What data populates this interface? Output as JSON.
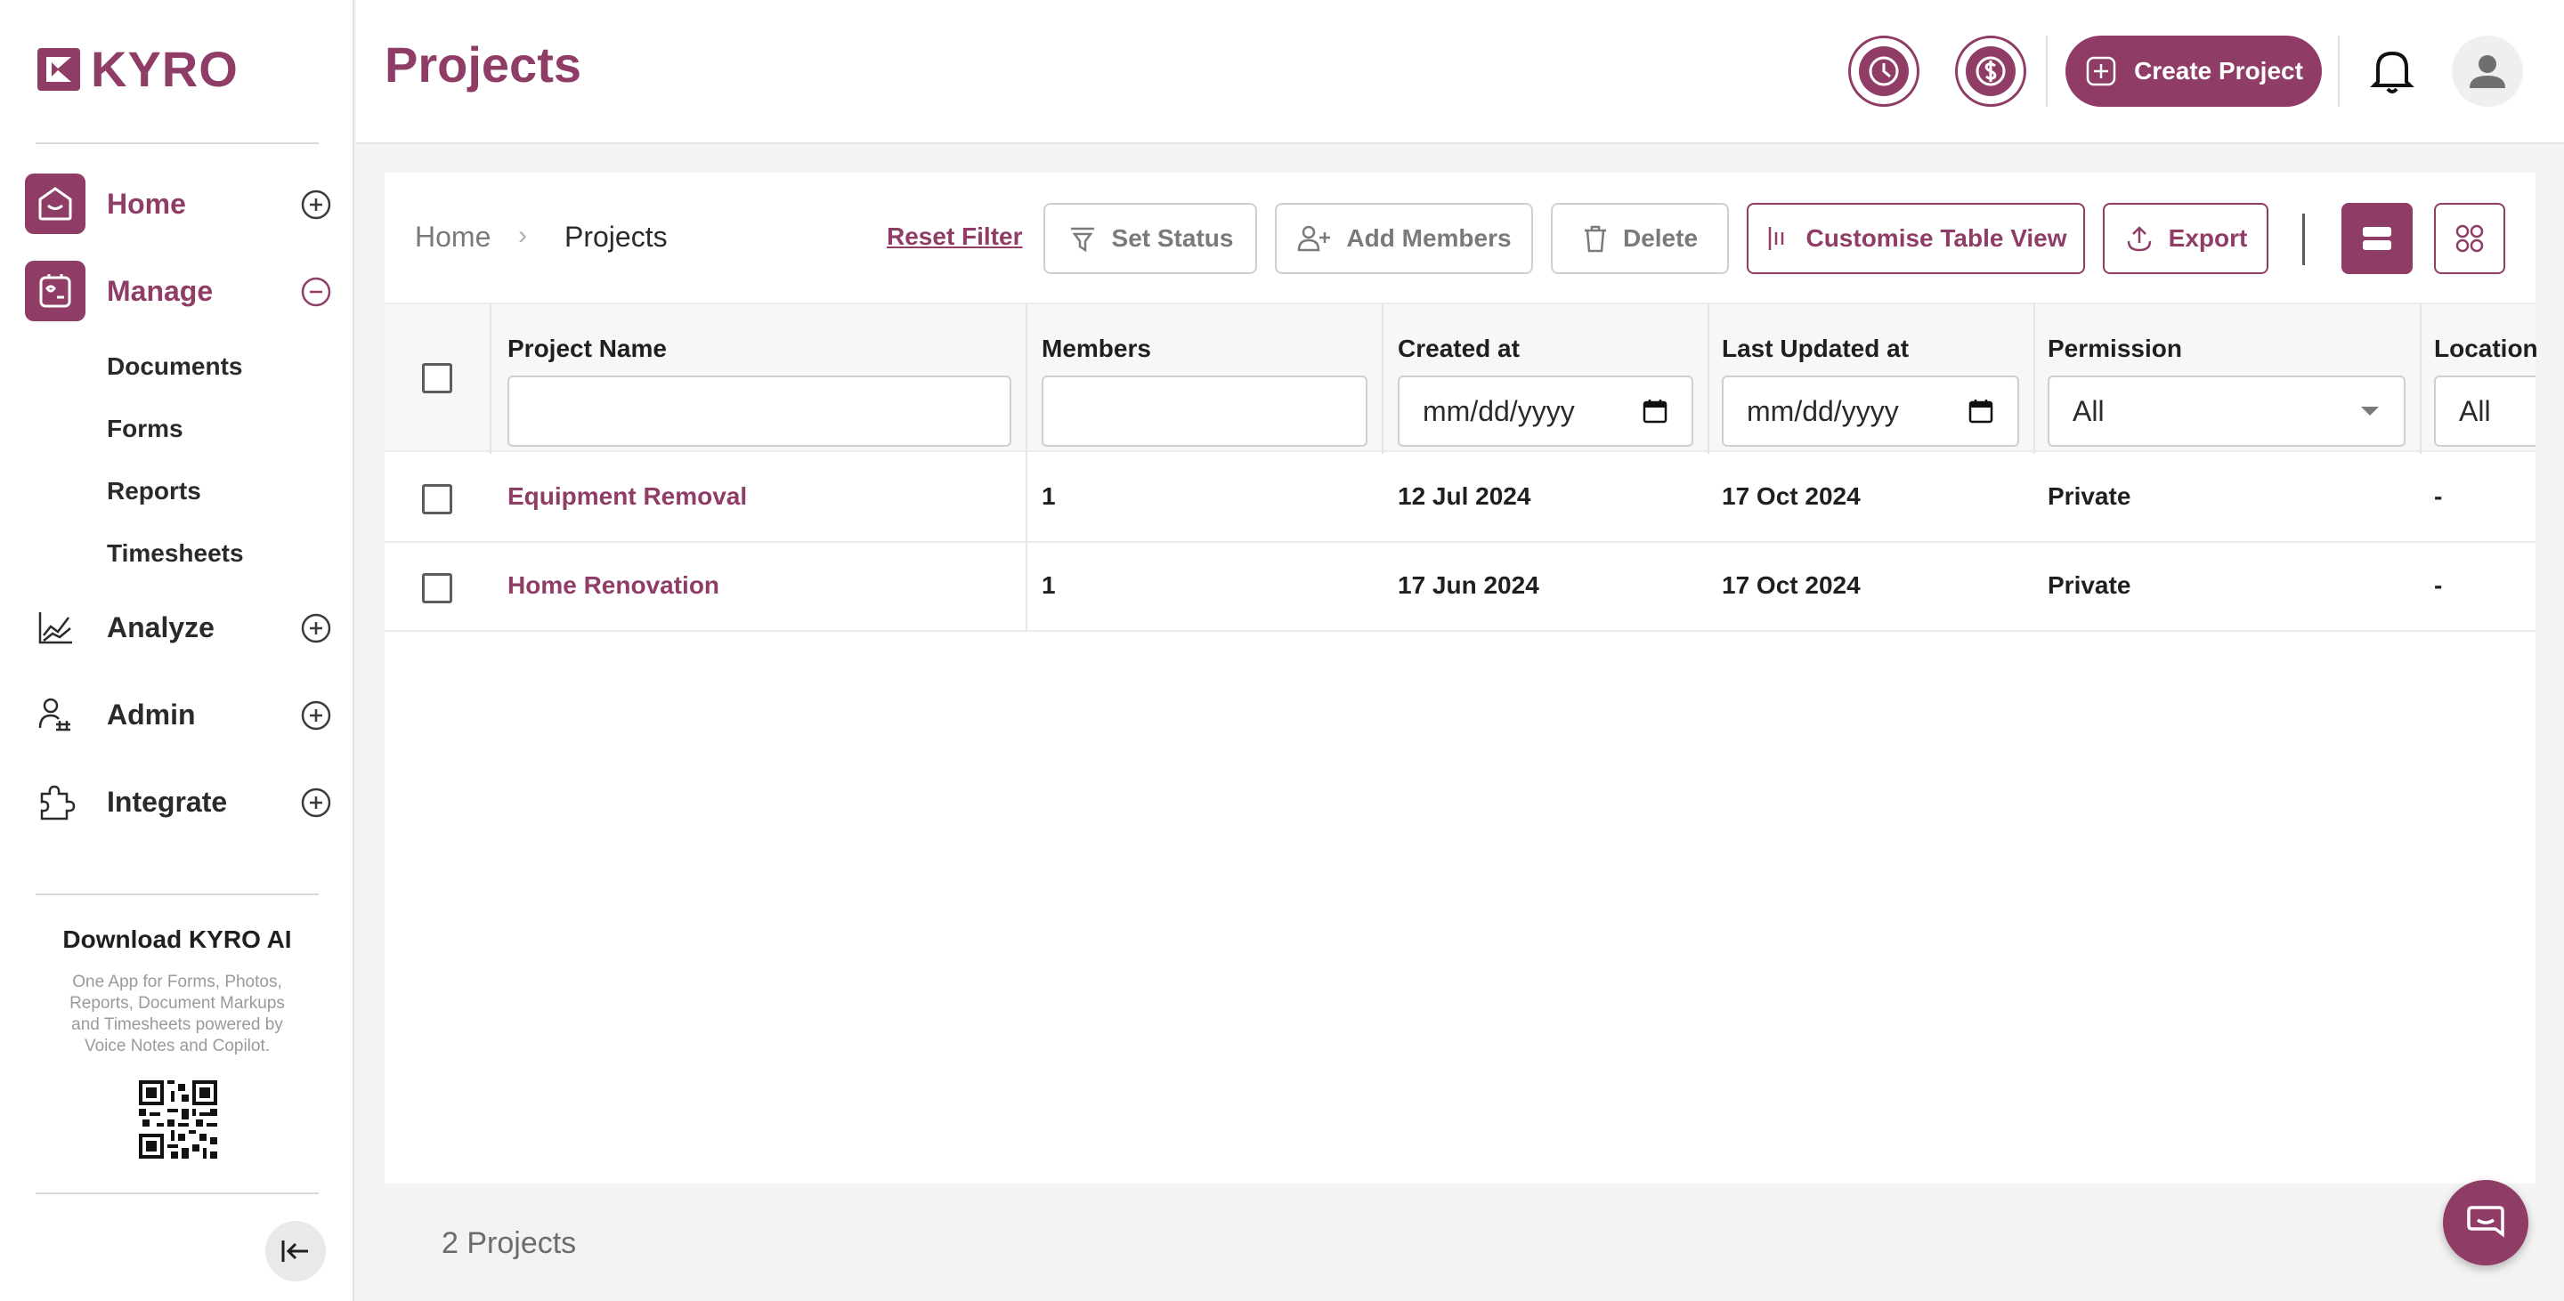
{
  "app": {
    "brand": "KYRO",
    "page_title": "Projects"
  },
  "sidebar": {
    "items": [
      {
        "label": "Home"
      },
      {
        "label": "Manage"
      },
      {
        "label": "Analyze"
      },
      {
        "label": "Admin"
      },
      {
        "label": "Integrate"
      }
    ],
    "manage_sub": [
      {
        "label": "Documents"
      },
      {
        "label": "Forms"
      },
      {
        "label": "Reports"
      },
      {
        "label": "Timesheets"
      }
    ],
    "download": {
      "title": "Download KYRO AI",
      "description": "One App for Forms, Photos, Reports, Document Markups and Timesheets powered by Voice Notes and Copilot."
    }
  },
  "header": {
    "create_label": "Create Project"
  },
  "breadcrumb": {
    "home": "Home",
    "sep": "›",
    "current": "Projects"
  },
  "toolbar": {
    "reset_filter": "Reset Filter",
    "set_status": "Set Status",
    "add_members": "Add Members",
    "delete": "Delete",
    "customise": "Customise Table View",
    "export": "Export"
  },
  "table": {
    "columns": [
      "Project Name",
      "Members",
      "Created at",
      "Last Updated at",
      "Permission",
      "Location"
    ],
    "filters": {
      "date_placeholder": "mm/dd/yyyy",
      "permission": "All",
      "location": "All"
    },
    "rows": [
      {
        "name": "Equipment Removal",
        "members": "1",
        "created": "12 Jul 2024",
        "updated": "17 Oct 2024",
        "permission": "Private",
        "location": "-"
      },
      {
        "name": "Home Renovation",
        "members": "1",
        "created": "17 Jun 2024",
        "updated": "17 Oct 2024",
        "permission": "Private",
        "location": "-"
      }
    ]
  },
  "footer": {
    "count": "2 Projects"
  },
  "colors": {
    "brand": "#8f3d66"
  },
  "icons": [
    "clock-icon",
    "dollar-icon",
    "plus-circle-icon",
    "bell-icon",
    "user-icon",
    "filter-icon",
    "user-plus-icon",
    "trash-icon",
    "columns-icon",
    "upload-icon",
    "list-view-icon",
    "grid-view-icon",
    "chat-icon",
    "collapse-icon",
    "qr-code"
  ]
}
